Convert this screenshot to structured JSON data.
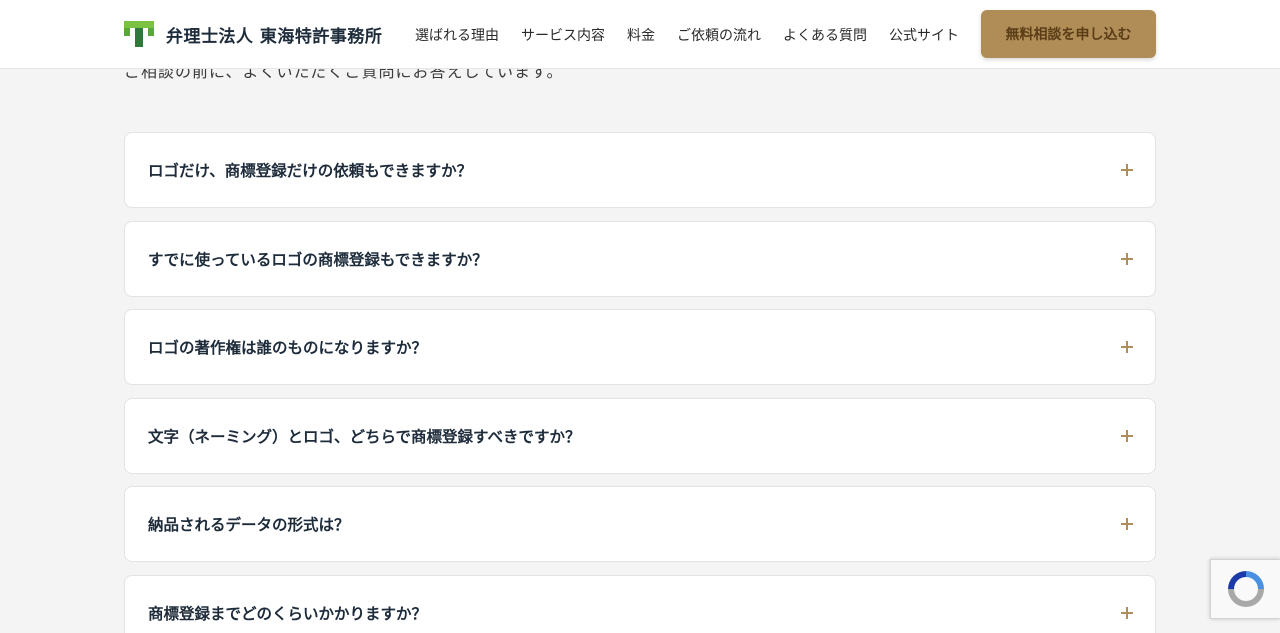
{
  "header": {
    "logo_text": "弁理士法人 東海特許事務所",
    "nav": [
      "選ばれる理由",
      "サービス内容",
      "料金",
      "ご依頼の流れ",
      "よくある質問",
      "公式サイト"
    ],
    "cta_label": "無料相談を申し込む"
  },
  "intro_text": "ご相談の前に、よくいただくご質問にお答えしています。",
  "faq": [
    "ロゴだけ、商標登録だけの依頼もできますか？",
    "すでに使っているロゴの商標登録もできますか？",
    "ロゴの著作権は誰のものになりますか？",
    "文字（ネーミング）とロゴ、どちらで商標登録すべきですか？",
    "納品されるデータの形式は？",
    "商標登録までどのくらいかかりますか？"
  ],
  "colors": {
    "accent": "#b08d57",
    "text": "#1d2b3a",
    "logo_green": "#7cc242",
    "logo_dark": "#2f7a3a"
  },
  "icons": {
    "faq_toggle": "plus-icon",
    "recaptcha": "recaptcha-icon"
  }
}
